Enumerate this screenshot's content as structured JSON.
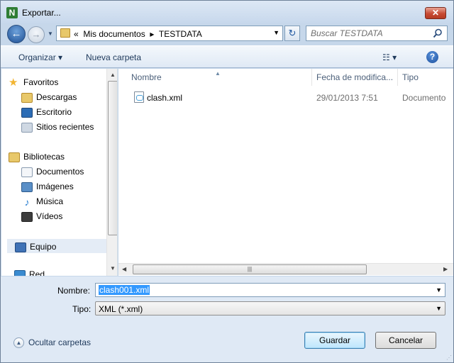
{
  "window": {
    "title": "Exportar...",
    "close_symbol": "✕"
  },
  "navigation": {
    "back_symbol": "←",
    "forward_symbol": "→",
    "breadcrumb_chevron": "«",
    "breadcrumb": [
      "Mis documentos",
      "TESTDATA"
    ],
    "breadcrumb_sep": "▸",
    "refresh_symbol": "↻",
    "search_placeholder": "Buscar TESTDATA"
  },
  "toolbar": {
    "organize": "Organizar ▾",
    "new_folder": "Nueva carpeta",
    "views_symbol": "☷ ▾",
    "help_symbol": "?"
  },
  "sidebar": {
    "items": [
      {
        "label": "Favoritos",
        "icon": "star-icon",
        "color": "#f2b532"
      },
      {
        "label": "Descargas",
        "icon": "downloads-folder-icon",
        "color": "#e8c86a"
      },
      {
        "label": "Escritorio",
        "icon": "desktop-icon",
        "color": "#2c6cb5"
      },
      {
        "label": "Sitios recientes",
        "icon": "recent-places-icon",
        "color": "#8a9bb0"
      },
      {
        "label": "Bibliotecas",
        "icon": "libraries-icon",
        "color": "#e8c86a"
      },
      {
        "label": "Documentos",
        "icon": "documents-icon",
        "color": "#dde6f0"
      },
      {
        "label": "Imágenes",
        "icon": "pictures-icon",
        "color": "#5a8fc7"
      },
      {
        "label": "Música",
        "icon": "music-icon",
        "color": "#2a7fd1"
      },
      {
        "label": "Vídeos",
        "icon": "videos-icon",
        "color": "#3d3d3d"
      },
      {
        "label": "Equipo",
        "icon": "computer-icon",
        "color": "#3f72b6"
      },
      {
        "label": "Red",
        "icon": "network-icon",
        "color": "#3a8bd0"
      }
    ]
  },
  "file_list": {
    "columns": [
      "Nombre",
      "Fecha de modifica...",
      "Tipo"
    ],
    "rows": [
      {
        "name": "clash.xml",
        "date": "29/01/2013 7:51",
        "type": "Documento"
      }
    ]
  },
  "form": {
    "filename_label": "Nombre:",
    "filename_value": "clash001.xml",
    "filetype_label": "Tipo:",
    "filetype_value": "XML (*.xml)"
  },
  "footer": {
    "hide_folders": "Ocultar carpetas",
    "save": "Guardar",
    "cancel": "Cancelar"
  }
}
